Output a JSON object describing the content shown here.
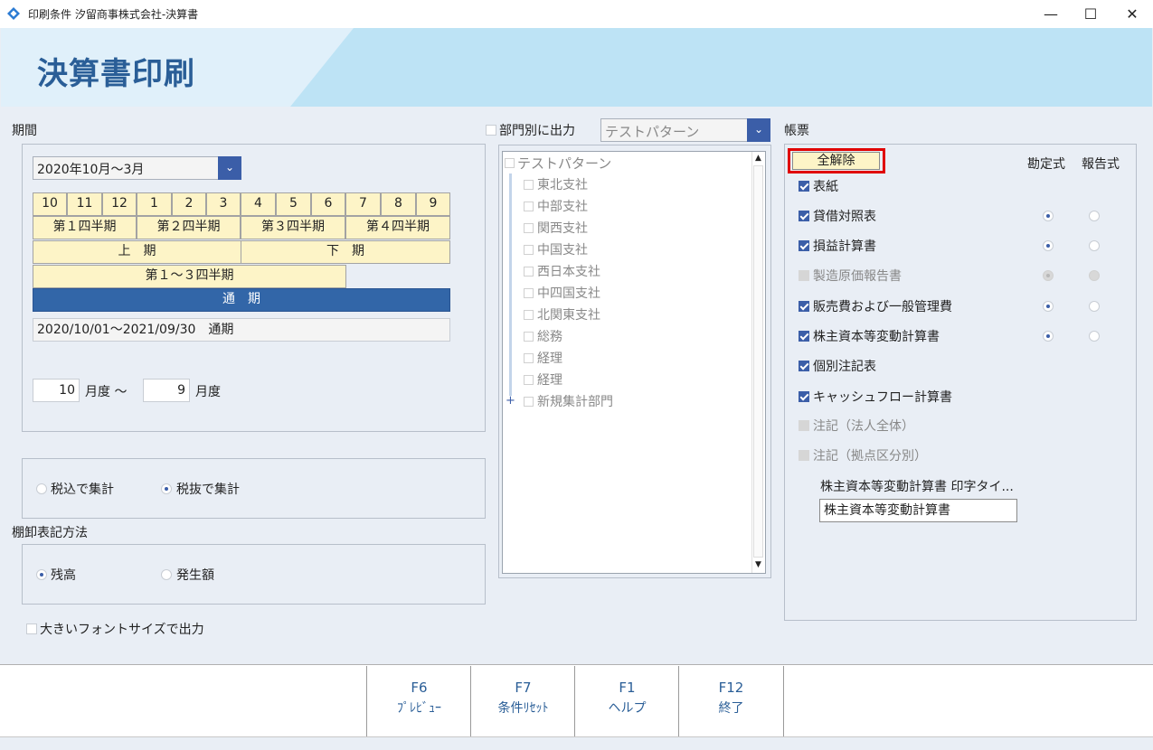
{
  "window": {
    "title": "印刷条件 汐留商事株式会社-決算書",
    "minimize": "—",
    "maximize": "☐",
    "close": "✕"
  },
  "header": {
    "title": "決算書印刷"
  },
  "period": {
    "label": "期間",
    "select_value": "2020年10月～3月",
    "months": [
      "10",
      "11",
      "12",
      "1",
      "2",
      "3",
      "4",
      "5",
      "6",
      "7",
      "8",
      "9"
    ],
    "quarters": [
      "第１四半期",
      "第２四半期",
      "第３四半期",
      "第４四半期"
    ],
    "halves": [
      "上　期",
      "下　期"
    ],
    "q1_3": "第１～３四半期",
    "full": "通　期",
    "range_text": "2020/10/01～2021/09/30　通期",
    "from_month": "10",
    "from_suffix": "月度 ～",
    "to_month": "9",
    "to_suffix": "月度"
  },
  "tax": {
    "incl": "税込で集計",
    "excl": "税抜で集計",
    "selected": "excl"
  },
  "inventory": {
    "label": "棚卸表記方法",
    "balance": "残高",
    "amount": "発生額",
    "selected": "balance"
  },
  "large_font": {
    "label": "大きいフォントサイズで出力",
    "checked": false
  },
  "department": {
    "check_label": "部門別に出力",
    "pattern_value": "テストパターン",
    "root": "テストパターン",
    "items": [
      "東北支社",
      "中部支社",
      "関西支社",
      "中国支社",
      "西日本支社",
      "中四国支社",
      "北関東支社",
      "総務",
      "経理",
      "経理",
      "新規集計部門"
    ],
    "expand_icon": "+"
  },
  "forms": {
    "label": "帳票",
    "clear_all": "全解除",
    "col_kanjou": "勘定式",
    "col_houkoku": "報告式",
    "items": [
      {
        "label": "表紙",
        "checked": true,
        "enabled": true,
        "radios": false
      },
      {
        "label": "貸借対照表",
        "checked": true,
        "enabled": true,
        "radios": true,
        "format": "kanjou"
      },
      {
        "label": "損益計算書",
        "checked": true,
        "enabled": true,
        "radios": true,
        "format": "kanjou"
      },
      {
        "label": "製造原価報告書",
        "checked": false,
        "enabled": false,
        "radios": true,
        "format": "kanjou"
      },
      {
        "label": "販売費および一般管理費",
        "checked": true,
        "enabled": true,
        "radios": true,
        "format": "kanjou"
      },
      {
        "label": "株主資本等変動計算書",
        "checked": true,
        "enabled": true,
        "radios": true,
        "format": "kanjou"
      },
      {
        "label": "個別注記表",
        "checked": true,
        "enabled": true,
        "radios": false
      },
      {
        "label": "キャッシュフロー計算書",
        "checked": true,
        "enabled": true,
        "radios": false
      },
      {
        "label": "注記（法人全体）",
        "checked": false,
        "enabled": false,
        "radios": false
      },
      {
        "label": "注記（拠点区分別）",
        "checked": false,
        "enabled": false,
        "radios": false
      }
    ],
    "print_title_label": "株主資本等変動計算書 印字タイ...",
    "print_title_value": "株主資本等変動計算書"
  },
  "footer": {
    "keys": [
      {
        "key": "F6",
        "name": "ﾌﾟﾚﾋﾞｭｰ"
      },
      {
        "key": "F7",
        "name": "条件ﾘｾｯﾄ"
      },
      {
        "key": "F1",
        "name": "ヘルプ"
      },
      {
        "key": "F12",
        "name": "終了"
      }
    ]
  },
  "colors": {
    "accent": "#3b5ea8",
    "title": "#2a5e97",
    "period_cell": "#fdf4c7",
    "period_selected": "#3266a8",
    "highlight_border": "#e00000"
  }
}
